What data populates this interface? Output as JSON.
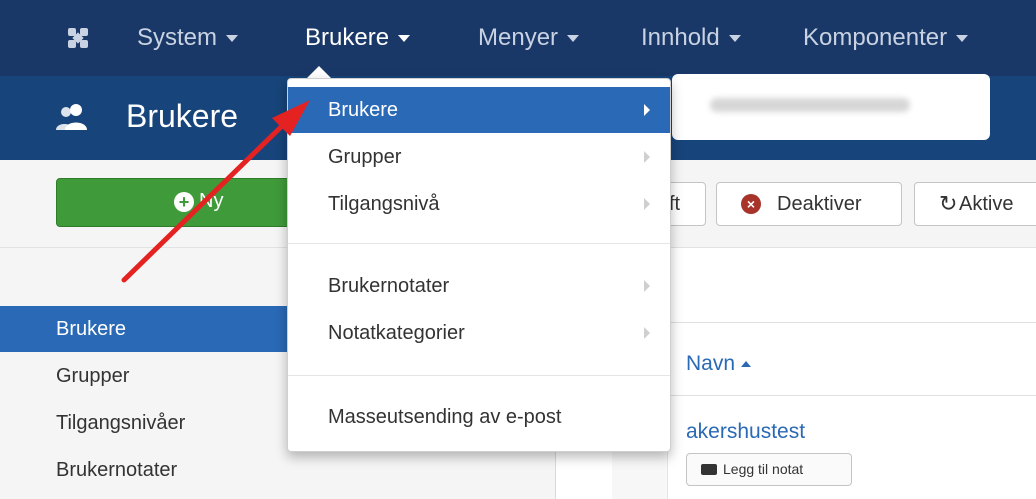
{
  "navbar": {
    "logo_icon": "joomla-logo-icon",
    "items": [
      {
        "label": "System"
      },
      {
        "label": "Brukere"
      },
      {
        "label": "Menyer"
      },
      {
        "label": "Innhold"
      },
      {
        "label": "Komponenter"
      }
    ]
  },
  "header": {
    "icon": "users-icon",
    "title": "Brukere"
  },
  "toolbar": {
    "new_label": "Ny",
    "partial_label": "ft",
    "deactivate_label": "Deaktiver",
    "activate_label": "Aktive"
  },
  "dropdown": {
    "items": [
      {
        "label": "Brukere"
      },
      {
        "label": "Grupper"
      },
      {
        "label": "Tilgangsnivå"
      },
      {
        "label": "Brukernotater"
      },
      {
        "label": "Notatkategorier"
      },
      {
        "label": "Masseutsending av e-post"
      }
    ]
  },
  "sidebar": {
    "items": [
      {
        "label": "Brukere"
      },
      {
        "label": "Grupper"
      },
      {
        "label": "Tilgangsnivåer"
      },
      {
        "label": "Brukernotater"
      }
    ]
  },
  "table": {
    "name_header": "Navn",
    "row_user": "akershustest",
    "add_note_label": "Legg til notat"
  },
  "colors": {
    "navbar": "#1a3867",
    "header": "#17447a",
    "active_blue": "#2a69b5",
    "new_button": "#3f9a3a",
    "annotation_arrow": "#e52222"
  }
}
